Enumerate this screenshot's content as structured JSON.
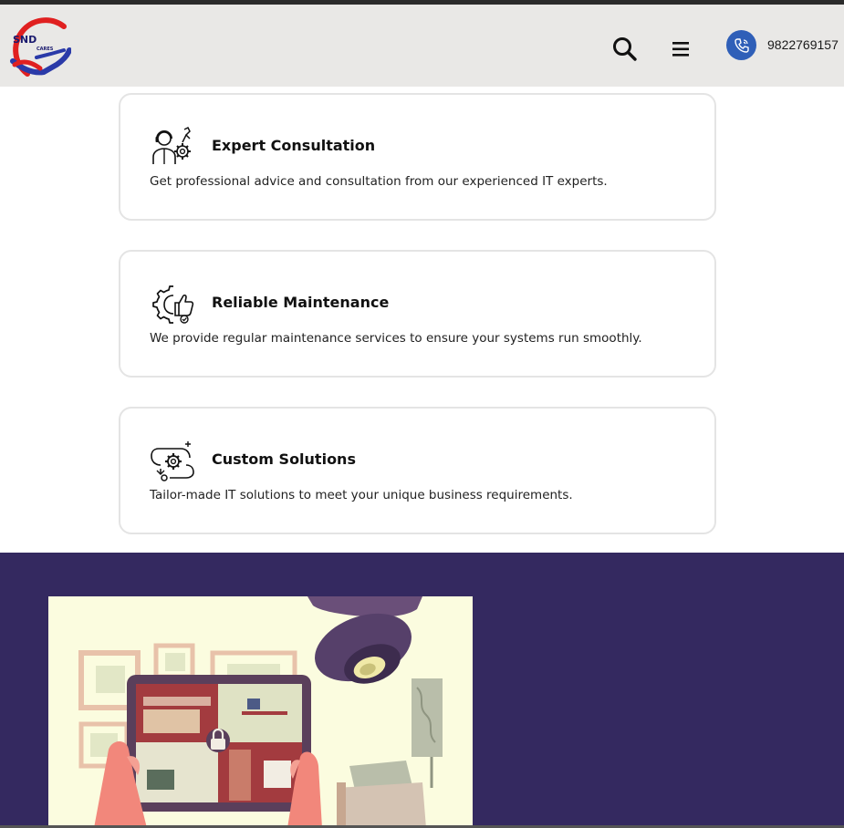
{
  "header": {
    "logo_text": "SND",
    "logo_subtext": "CARES",
    "phone_number": "9822769157",
    "icons": {
      "search": "search-icon",
      "menu": "hamburger-menu-icon",
      "phone": "phone-icon"
    },
    "colors": {
      "background": "#e9e8e6",
      "phone_circle": "#2f5fb8",
      "logo_red": "#e02020",
      "logo_blue": "#2a3aa8"
    }
  },
  "features": [
    {
      "title": "Expert Consultation",
      "description": "Get professional advice and consultation from our experienced IT experts.",
      "icon": "consultant-gear-icon"
    },
    {
      "title": "Reliable Maintenance",
      "description": "We provide regular maintenance services to ensure your systems run smoothly.",
      "icon": "gear-thumbs-up-icon"
    },
    {
      "title": "Custom Solutions",
      "description": "Tailor-made IT solutions to meet your unique business requirements.",
      "icon": "gear-workflow-icon"
    }
  ],
  "banner": {
    "background": "#342960",
    "illustration": "smart-home-security-tablet-illustration"
  }
}
